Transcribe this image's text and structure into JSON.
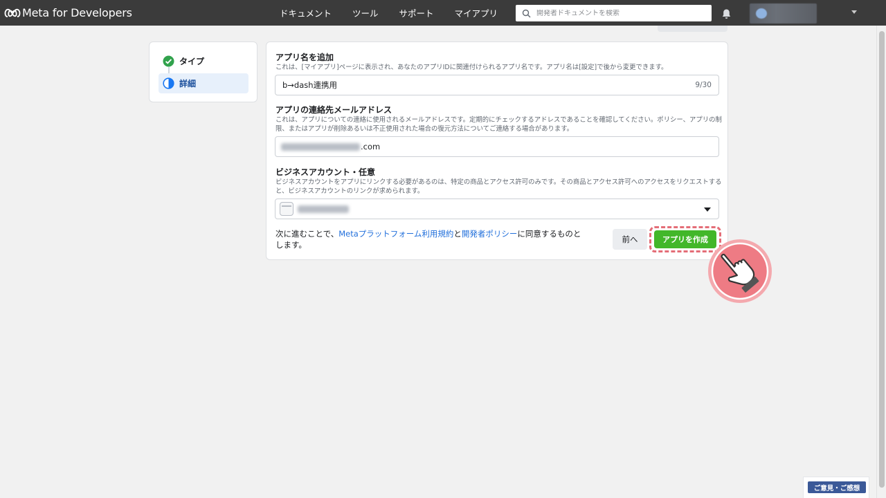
{
  "nav": {
    "brand": "Meta for Developers",
    "links": [
      "ドキュメント",
      "ツール",
      "サポート",
      "マイアプリ"
    ],
    "search_placeholder": "開発者ドキュメントを検索"
  },
  "steps": [
    {
      "label": "タイプ",
      "status": "complete"
    },
    {
      "label": "詳細",
      "status": "current"
    }
  ],
  "form": {
    "app_name": {
      "label": "アプリ名を追加",
      "description": "これは、[マイアプリ]ページに表示され、あなたのアプリIDに関連付けられるアプリ名です。アプリ名は[設定]で後から変更できます。",
      "value": "b→dash連携用",
      "counter": "9/30"
    },
    "email": {
      "label": "アプリの連絡先メールアドレス",
      "description": "これは、アプリについての連絡に使用されるメールアドレスです。定期的にチェックするアドレスであることを確認してください。ポリシー、アプリの制限、またはアプリが削除あるいは不正使用された場合の復元方法についてご連絡する場合があります。",
      "value_suffix": ".com"
    },
    "business": {
      "label": "ビジネスアカウント・任意",
      "description": "ビジネスアカウントをアプリにリンクする必要があるのは、特定の商品とアクセス許可のみです。その商品とアクセス許可へのアクセスをリクエストすると、ビジネスアカウントのリンクが求められます。"
    },
    "terms": {
      "prefix": "次に進むことで、",
      "link1": "Metaプラットフォーム利用規約",
      "middle": "と",
      "link2": "開発者ポリシー",
      "suffix": "に同意するものとします。"
    },
    "back_label": "前へ",
    "create_label": "アプリを作成"
  },
  "feedback_label": "ご意見・ご感想",
  "colors": {
    "nav_bg": "#3b3b3b",
    "primary_green": "#42b72a",
    "link_blue": "#216fdb",
    "highlight_red": "#e46d77"
  }
}
